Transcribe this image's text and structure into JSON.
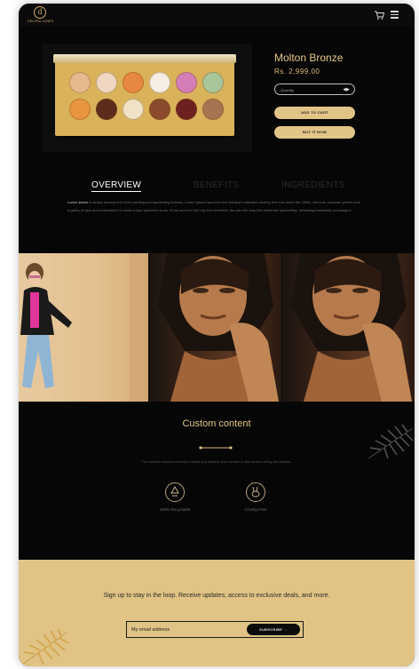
{
  "header": {
    "logo_text": "DELORA JONES",
    "cart_icon": "cart-icon",
    "menu_icon": "hamburger-menu-icon"
  },
  "product": {
    "title": "Molton Bronze",
    "price": "Rs. 2,999.00",
    "quantity_placeholder": "Quantity",
    "add_to_cart": "ADD TO CART",
    "buy_now": "BUY IT NOW",
    "palette_colors": [
      "#e7b98f",
      "#f1d7c2",
      "#e8873f",
      "#f4eee5",
      "#d47db6",
      "#a9c59b",
      "#e8953f",
      "#5d2c1c",
      "#efe2c6",
      "#8a4a2b",
      "#6e1f1f",
      "#a57552"
    ]
  },
  "tabs": [
    {
      "label": "OVERVIEW",
      "active": true
    },
    {
      "label": "BENEFITS",
      "active": false
    },
    {
      "label": "INGREDIENTS",
      "active": false
    }
  ],
  "overview": {
    "lead": "Lorem Ipsum",
    "text": " is simply dummy text of the printing and typesetting industry. Lorem Ipsum has been the industry's standard dummy text ever since the 1500s, when an unknown printer took a galley of type and scrambled it to make a type specimen book. It has survived not only five centuries, but also the leap into electronic typesetting, remaining essentially unchanged."
  },
  "custom": {
    "title": "Custom content",
    "description": "This section doesn't currently include any content. Add content to this section using the sidebar.",
    "features": [
      {
        "label": "100% Recyclable",
        "icon": "recycle-icon"
      },
      {
        "label": "Cruelty Free",
        "icon": "rabbit-icon"
      }
    ]
  },
  "newsletter": {
    "text": "Sign up to stay in the loop. Receive updates, access to exclusive deals, and more.",
    "placeholder": "My email address",
    "button": "SUBSCRIBE"
  },
  "colors": {
    "background": "#060606",
    "gold": "#e2c487",
    "newsletter_bg": "#e0c385"
  }
}
